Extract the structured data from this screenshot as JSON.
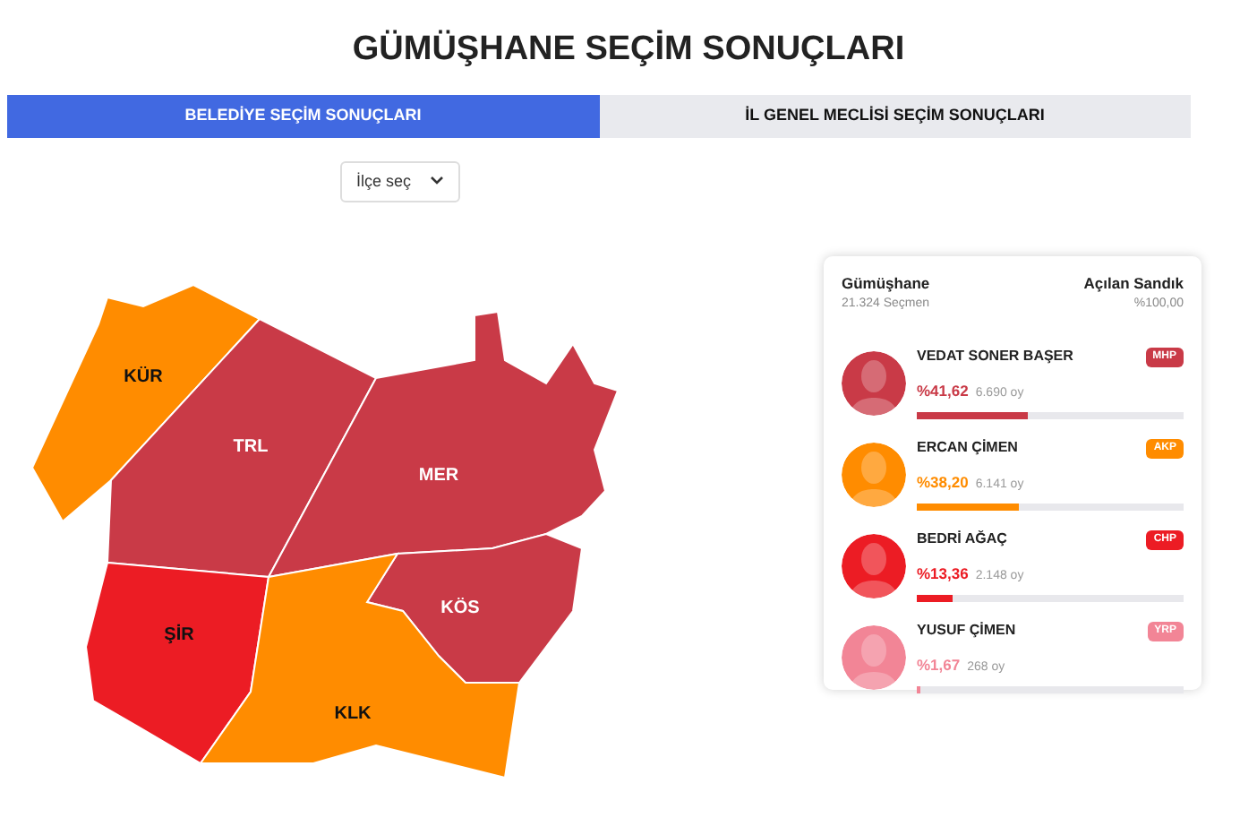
{
  "title": "GÜMÜŞHANE SEÇİM SONUÇLARI",
  "tabs": [
    {
      "label": "BELEDİYE SEÇİM SONUÇLARI",
      "selected": true
    },
    {
      "label": "İL GENEL MECLİSİ SEÇİM SONUÇLARI",
      "selected": false
    }
  ],
  "district_select": {
    "value": "İlçe seç"
  },
  "map": {
    "districts": [
      {
        "label": "KÜR",
        "color": "#ff8c00"
      },
      {
        "label": "TRL",
        "color": "#c93a47"
      },
      {
        "label": "MER",
        "color": "#c93a47"
      },
      {
        "label": "KÖS",
        "color": "#c93a47"
      },
      {
        "label": "ŞİR",
        "color": "#ec1c24"
      },
      {
        "label": "KLK",
        "color": "#ff8c00"
      }
    ]
  },
  "results": {
    "place": "Gümüşhane",
    "voters": "21.324 Seçmen",
    "opened_label": "Açılan Sandık",
    "opened_value": "%100,00",
    "candidates": [
      {
        "name": "VEDAT SONER BAŞER",
        "party": "MHP",
        "percent": "%41,62",
        "votes": "6.690 oy",
        "level": 0.4162,
        "color": "#c93a47"
      },
      {
        "name": "ERCAN ÇİMEN",
        "party": "AKP",
        "percent": "%38,20",
        "votes": "6.141 oy",
        "level": 0.382,
        "color": "#ff8c00"
      },
      {
        "name": "BEDRİ AĞAÇ",
        "party": "CHP",
        "percent": "%13,36",
        "votes": "2.148 oy",
        "level": 0.1336,
        "color": "#ec1c24"
      },
      {
        "name": "YUSUF ÇİMEN",
        "party": "YRP",
        "percent": "%1,67",
        "votes": "268 oy",
        "level": 0.0167,
        "color": "#f28596"
      }
    ]
  }
}
